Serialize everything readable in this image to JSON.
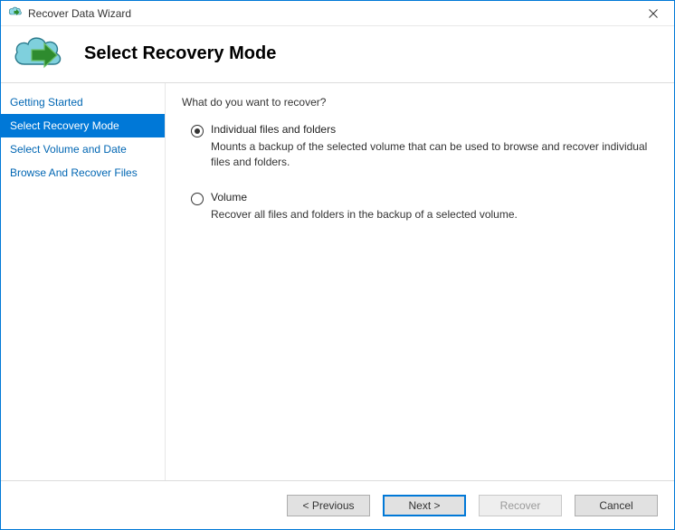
{
  "window": {
    "title": "Recover Data Wizard"
  },
  "header": {
    "page_title": "Select Recovery Mode"
  },
  "sidebar": {
    "items": [
      {
        "label": "Getting Started",
        "selected": false
      },
      {
        "label": "Select Recovery Mode",
        "selected": true
      },
      {
        "label": "Select Volume and Date",
        "selected": false
      },
      {
        "label": "Browse And Recover Files",
        "selected": false
      }
    ]
  },
  "main": {
    "prompt": "What do you want to recover?",
    "options": [
      {
        "label": "Individual files and folders",
        "description": "Mounts a backup of the selected volume that can be used to browse and recover individual files and folders.",
        "checked": true
      },
      {
        "label": "Volume",
        "description": "Recover all files and folders in the backup of a selected volume.",
        "checked": false
      }
    ]
  },
  "footer": {
    "previous": "< Previous",
    "next": "Next >",
    "recover": "Recover",
    "cancel": "Cancel"
  }
}
